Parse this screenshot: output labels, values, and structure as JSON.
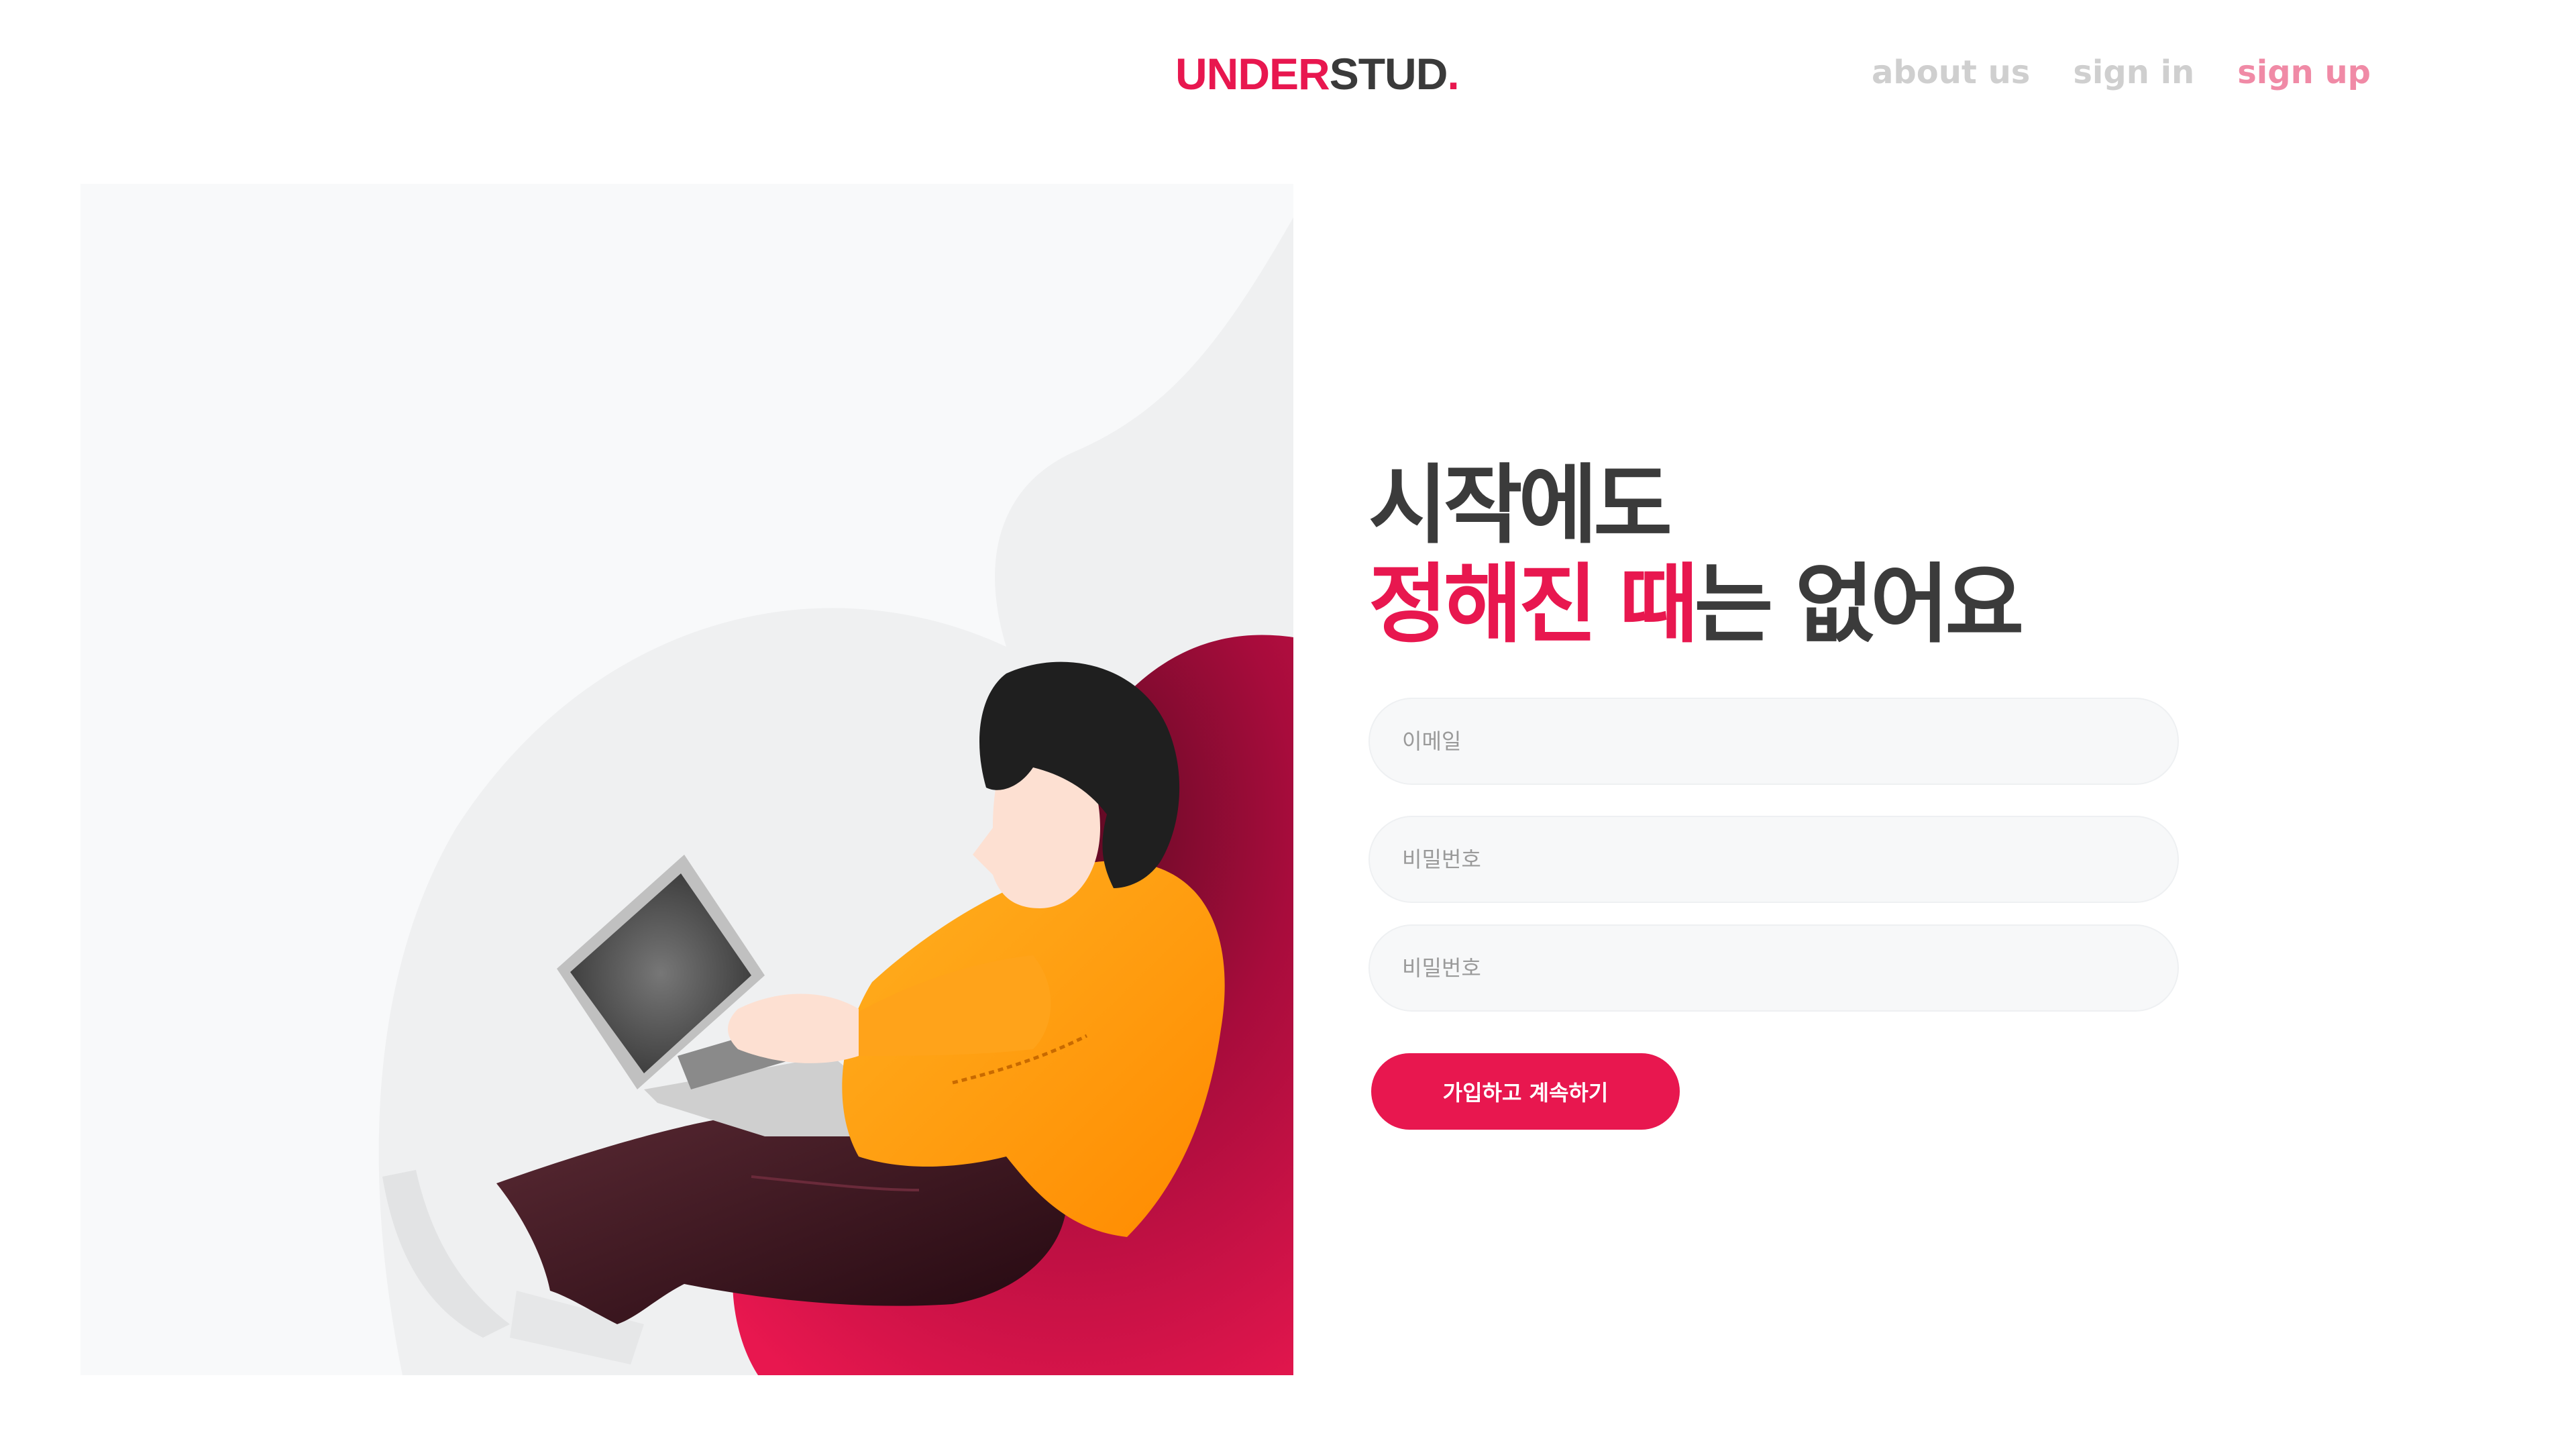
{
  "brand": {
    "part1": "UNDER",
    "part2": "STUD",
    "part3": ".",
    "colors": {
      "accent": "#e8174f",
      "dark": "#3a3a3a"
    }
  },
  "nav": {
    "about": "about us",
    "sign_in": "sign in",
    "sign_up": "sign up"
  },
  "hero": {
    "line1": "시작에도",
    "line2_accent": "정해진 때",
    "line2_rest": "는 없어요"
  },
  "form": {
    "email_placeholder": "이메일",
    "password_placeholder": "비밀번호",
    "password_confirm_placeholder": "비밀번호",
    "submit_label": "가입하고 계속하기"
  },
  "illustration": {
    "icon": "person-with-laptop-illustration",
    "colors": {
      "chair": "#c8104a",
      "sweater": "#ffa31a",
      "pants": "#3a1520",
      "hair": "#1f1f1f",
      "skin": "#fde0d2"
    }
  }
}
